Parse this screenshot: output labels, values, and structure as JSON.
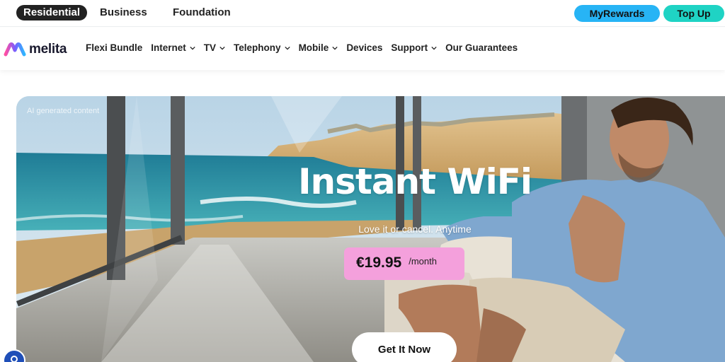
{
  "topbar": {
    "segments": [
      "Residential",
      "Business",
      "Foundation"
    ],
    "my_rewards": "MyRewards",
    "top_up": "Top Up"
  },
  "navbar": {
    "logo": "melita",
    "items": [
      "Flexi Bundle",
      "Internet",
      "TV",
      "Telephony",
      "Mobile",
      "Devices",
      "Support",
      "Our Guarantees"
    ]
  },
  "hero": {
    "ai_note": "AI generated content",
    "headline": "Instant WiFi",
    "tagline": "Love it or cancel. Anytime",
    "price": "€19.95",
    "price_period": "/month",
    "cta": "Get It Now"
  },
  "colors": {
    "rewards": "#27b4f5",
    "topup": "#1fd3c4",
    "price_badge": "#f4a0dc",
    "active_segment": "#222222"
  },
  "icons": [
    "chevron-down-icon",
    "melita-logo-icon",
    "accessibility-icon"
  ]
}
